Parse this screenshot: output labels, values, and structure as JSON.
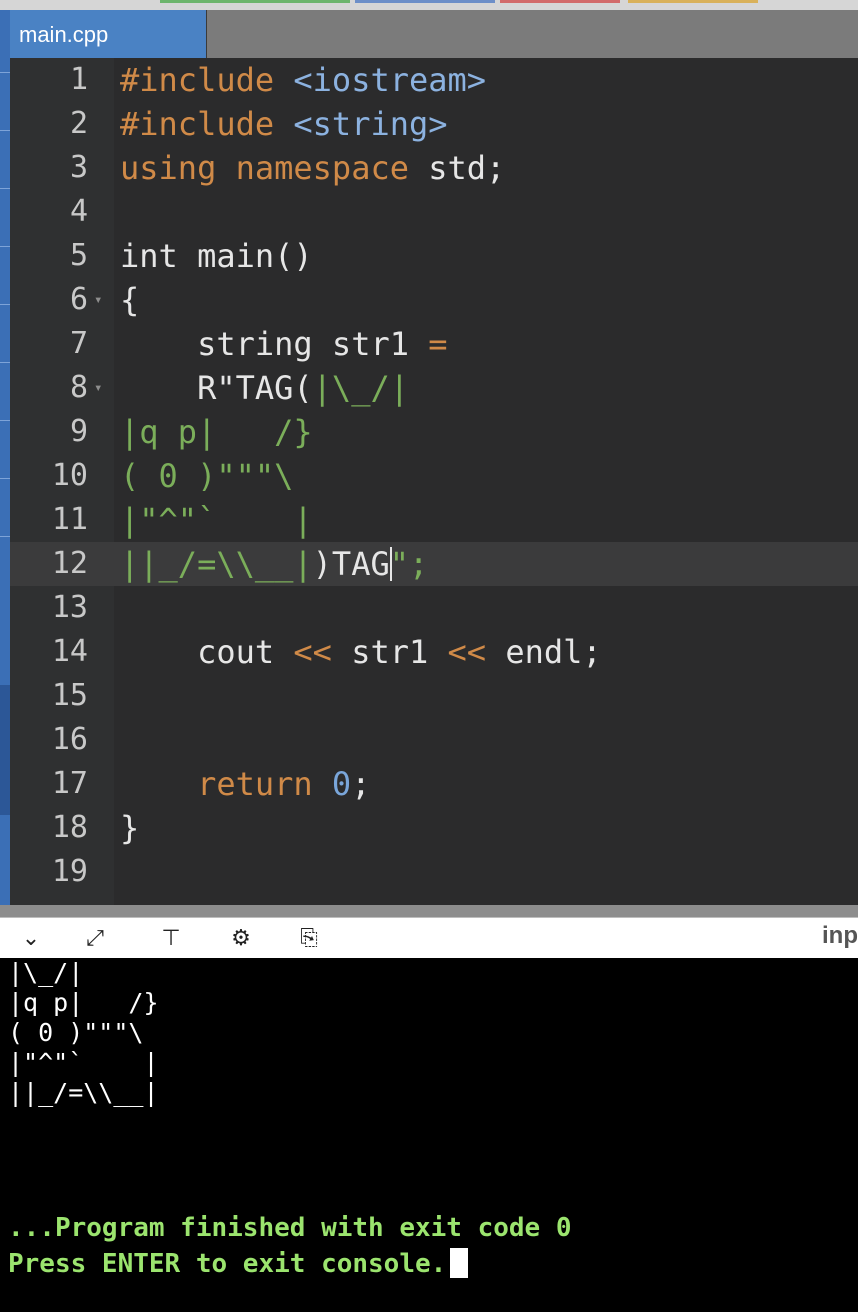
{
  "tab": {
    "filename": "main.cpp"
  },
  "editor": {
    "lines": [
      {
        "n": "1",
        "fold": false,
        "parts": [
          {
            "c": "kw",
            "t": "#include "
          },
          {
            "c": "inc",
            "t": "<iostream>"
          }
        ]
      },
      {
        "n": "2",
        "fold": false,
        "parts": [
          {
            "c": "kw",
            "t": "#include "
          },
          {
            "c": "inc",
            "t": "<string>"
          }
        ]
      },
      {
        "n": "3",
        "fold": false,
        "parts": [
          {
            "c": "kw",
            "t": "using namespace "
          },
          {
            "c": "raw",
            "t": "std;"
          }
        ]
      },
      {
        "n": "4",
        "fold": false,
        "parts": []
      },
      {
        "n": "5",
        "fold": false,
        "parts": [
          {
            "c": "raw",
            "t": "int main()"
          }
        ]
      },
      {
        "n": "6",
        "fold": true,
        "parts": [
          {
            "c": "raw",
            "t": "{"
          }
        ]
      },
      {
        "n": "7",
        "fold": false,
        "parts": [
          {
            "c": "raw",
            "t": "    string str1 "
          },
          {
            "c": "op",
            "t": "="
          }
        ]
      },
      {
        "n": "8",
        "fold": true,
        "parts": [
          {
            "c": "raw",
            "t": "    R\"TAG("
          },
          {
            "c": "str",
            "t": "|\\_/|"
          }
        ]
      },
      {
        "n": "9",
        "fold": false,
        "parts": [
          {
            "c": "str",
            "t": "|q p|   /}"
          }
        ]
      },
      {
        "n": "10",
        "fold": false,
        "parts": [
          {
            "c": "str",
            "t": "( 0 )\"\"\"\\"
          }
        ]
      },
      {
        "n": "11",
        "fold": false,
        "parts": [
          {
            "c": "str",
            "t": "|\"^\"`    |"
          }
        ]
      },
      {
        "n": "12",
        "fold": false,
        "active": true,
        "parts": [
          {
            "c": "str",
            "t": "||_/=\\\\__|"
          },
          {
            "c": "raw",
            "t": ")TAG"
          },
          {
            "c": "cursor",
            "t": ""
          },
          {
            "c": "str",
            "t": "\";"
          }
        ]
      },
      {
        "n": "13",
        "fold": false,
        "parts": []
      },
      {
        "n": "14",
        "fold": false,
        "parts": [
          {
            "c": "raw",
            "t": "    cout "
          },
          {
            "c": "op",
            "t": "<<"
          },
          {
            "c": "raw",
            "t": " str1 "
          },
          {
            "c": "op",
            "t": "<<"
          },
          {
            "c": "raw",
            "t": " endl;"
          }
        ]
      },
      {
        "n": "15",
        "fold": false,
        "parts": []
      },
      {
        "n": "16",
        "fold": false,
        "parts": []
      },
      {
        "n": "17",
        "fold": false,
        "parts": [
          {
            "c": "kw",
            "t": "    return "
          },
          {
            "c": "num",
            "t": "0"
          },
          {
            "c": "raw",
            "t": ";"
          }
        ]
      },
      {
        "n": "18",
        "fold": false,
        "parts": [
          {
            "c": "raw",
            "t": "}"
          }
        ]
      },
      {
        "n": "19",
        "fold": false,
        "parts": []
      }
    ]
  },
  "console_toolbar": {
    "buttons": [
      {
        "name": "chevron-down-icon",
        "glyph": "⌄"
      },
      {
        "name": "expand-icon",
        "glyph": "⤢"
      },
      {
        "name": "split-panel-icon",
        "glyph": "⊤"
      },
      {
        "name": "gear-icon",
        "glyph": "⚙"
      },
      {
        "name": "clipboard-icon",
        "glyph": "⎘"
      }
    ],
    "input_label": "inp"
  },
  "console": {
    "output_lines": [
      "|\\_/|",
      "|q p|   /}",
      "( 0 )\"\"\"\\",
      "|\"^\"`    |",
      "||_/=\\\\__|"
    ],
    "finished_message": "...Program finished with exit code 0",
    "exit_prompt": "Press ENTER to exit console."
  }
}
